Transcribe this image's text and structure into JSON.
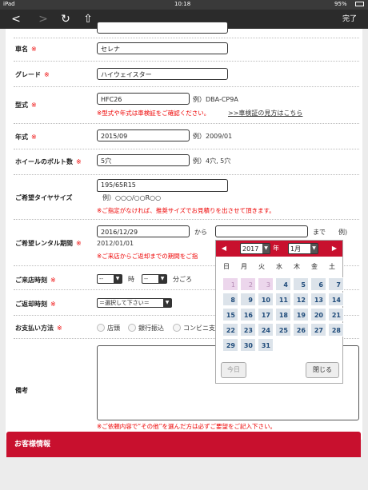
{
  "status": {
    "device": "iPad",
    "time": "10:18",
    "battery": "95%"
  },
  "toolbar": {
    "back": "<",
    "forward": ">",
    "reload": "↻",
    "share": "⇧",
    "done": "完了"
  },
  "form": {
    "car_name": {
      "label": "車名",
      "req": "※",
      "value": "セレナ"
    },
    "grade": {
      "label": "グレード",
      "req": "※",
      "value": "ハイウェイスター"
    },
    "model": {
      "label": "型式",
      "req": "※",
      "value": "HFC26",
      "example": "例）DBA-CP9A",
      "note": "※型式や年式は車検証をご確認ください。",
      "link": ">>車検証の見方はこちら"
    },
    "year": {
      "label": "年式",
      "req": "※",
      "value": "2015/09",
      "example": "例）2009/01"
    },
    "bolts": {
      "label": "ホイールのボルト数",
      "req": "※",
      "value": "5穴",
      "example": "例）4穴, 5穴"
    },
    "tire": {
      "label": "ご希望タイヤサイズ",
      "value": "195/65R15",
      "example": "例）○○○/○○R○○",
      "note": "※ご指定がなければ、推奨サイズでお見積りを出させて頂きます。"
    },
    "period": {
      "label": "ご希望レンタル期間",
      "req": "※",
      "from_value": "2016/12/29",
      "from": "から",
      "until": "まで",
      "example_label": "例)",
      "example": "2012/01/01",
      "note": "※ご来店からご返却までの期間をご指"
    },
    "visit": {
      "label": "ご来店時刻",
      "req": "※",
      "hour": "--",
      "ji": "時",
      "min": "--",
      "unit": "分ごろ"
    },
    "return": {
      "label": "ご返却時刻",
      "req": "※",
      "value": "＝選択して下さい＝"
    },
    "payment": {
      "label": "お支払い方法",
      "req": "※",
      "options": [
        "店頭",
        "銀行振込",
        "コンビニ支"
      ]
    },
    "remarks": {
      "label": "備考",
      "note": "※ご依頼内容で“その他”を選んだ方は必ずご要望をご記入下さい。"
    }
  },
  "customer_bar": "お客様情報",
  "datepicker": {
    "year": "2017",
    "nen": "年",
    "month": "1月",
    "prev": "◀",
    "next": "▶",
    "weekdays": [
      "日",
      "月",
      "火",
      "水",
      "木",
      "金",
      "土"
    ],
    "days": [
      [
        "1",
        "2",
        "3",
        "4",
        "5",
        "6",
        "7"
      ],
      [
        "8",
        "9",
        "10",
        "11",
        "12",
        "13",
        "14"
      ],
      [
        "15",
        "16",
        "17",
        "18",
        "19",
        "20",
        "21"
      ],
      [
        "22",
        "23",
        "24",
        "25",
        "26",
        "27",
        "28"
      ],
      [
        "29",
        "30",
        "31"
      ]
    ],
    "today": "今日",
    "close": "閉じる"
  }
}
